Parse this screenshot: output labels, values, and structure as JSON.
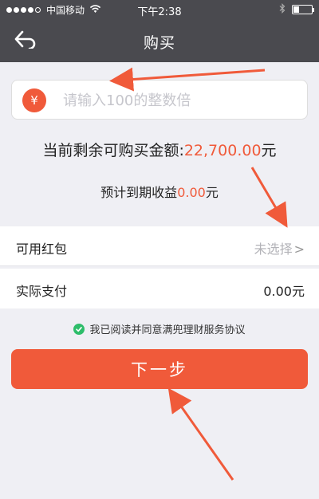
{
  "status_bar": {
    "carrier": "中国移动",
    "time": "下午2:38",
    "battery_level": 0.3
  },
  "nav": {
    "title": "购买"
  },
  "amount_input": {
    "placeholder": "请输入100的整数倍",
    "value": "",
    "currency_symbol": "¥"
  },
  "remaining": {
    "label": "当前剩余可购买金额:",
    "amount": "22,700.00",
    "unit": "元"
  },
  "profit": {
    "label": "预计到期收益",
    "amount": "0.00",
    "unit": "元"
  },
  "red_packet": {
    "label": "可用红包",
    "value": "未选择",
    "chevron": ">"
  },
  "actual_payment": {
    "label": "实际支付",
    "value": "0.00元"
  },
  "agreement": {
    "text": "我已阅读并同意满兜理财服务协议"
  },
  "next_button": {
    "label": "下一步"
  },
  "colors": {
    "accent": "#f05a3a",
    "nav_bg": "#4a4a4f",
    "check": "#2ebd6a",
    "page_bg": "#efeff4"
  },
  "icons": [
    "back-arrow-icon",
    "yen-icon",
    "check-icon",
    "wifi-icon",
    "bluetooth-icon",
    "battery-icon"
  ]
}
